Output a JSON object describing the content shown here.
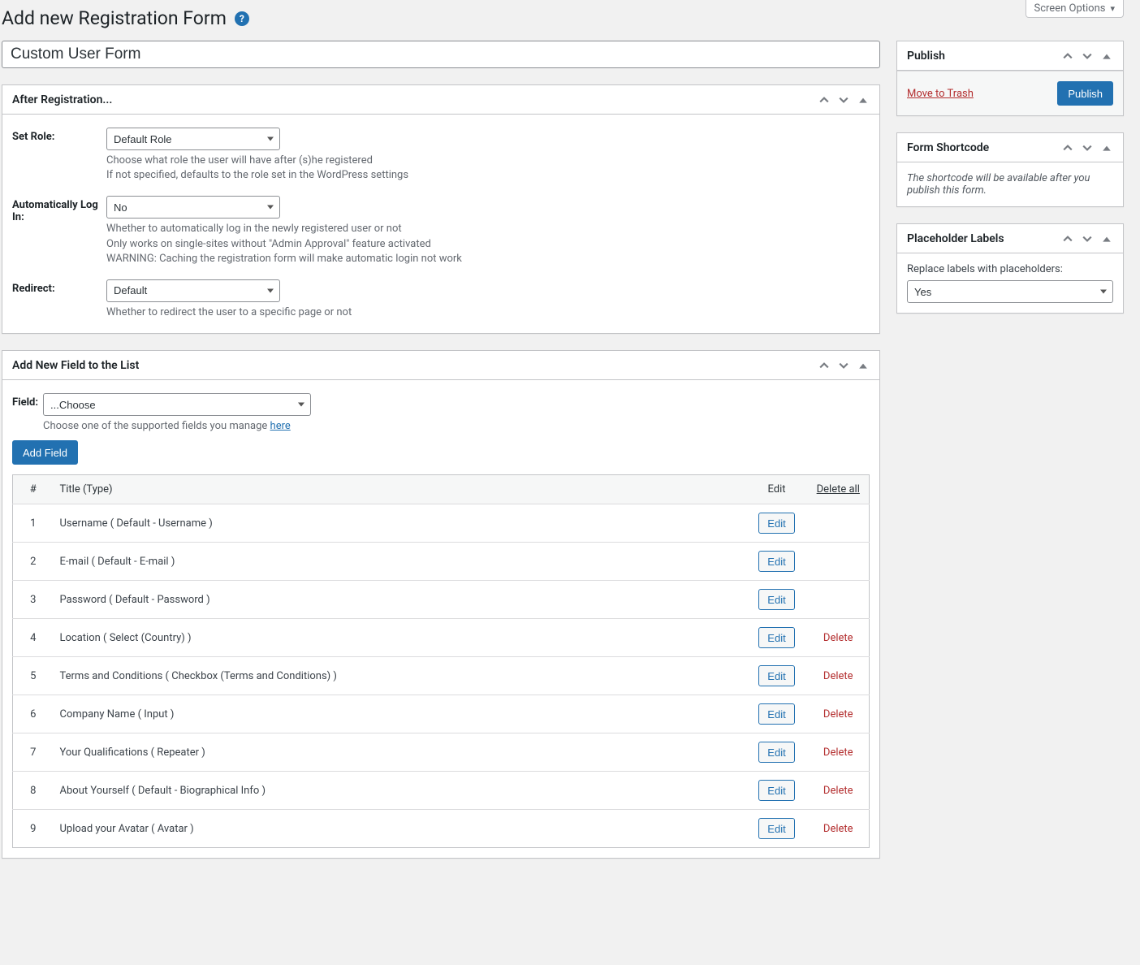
{
  "screen_options": "Screen Options",
  "page_title": "Add new Registration Form",
  "help_icon_label": "?",
  "title_input_value": "Custom User Form",
  "after_reg": {
    "box_title": "After Registration...",
    "set_role_label": "Set Role:",
    "set_role_value": "Default Role",
    "set_role_desc": "Choose what role the user will have after (s)he registered\nIf not specified, defaults to the role set in the WordPress settings",
    "auto_login_label": "Automatically Log In:",
    "auto_login_value": "No",
    "auto_login_desc": "Whether to automatically log in the newly registered user or not\nOnly works on single-sites without \"Admin Approval\" feature activated\nWARNING: Caching the registration form will make automatic login not work",
    "redirect_label": "Redirect:",
    "redirect_value": "Default",
    "redirect_desc": "Whether to redirect the user to a specific page or not"
  },
  "add_field": {
    "box_title": "Add New Field to the List",
    "field_label": "Field:",
    "field_select_value": "...Choose",
    "desc_prefix": "Choose one of the supported fields you manage ",
    "desc_link": "here",
    "add_button": "Add Field",
    "col_num": "#",
    "col_title": "Title (Type)",
    "col_edit": "Edit",
    "col_delete": "Delete all",
    "edit_btn": "Edit",
    "delete_btn": "Delete",
    "rows": [
      {
        "n": "1",
        "title": "Username ( Default - Username )",
        "deletable": false
      },
      {
        "n": "2",
        "title": "E-mail ( Default - E-mail )",
        "deletable": false
      },
      {
        "n": "3",
        "title": "Password ( Default - Password )",
        "deletable": false
      },
      {
        "n": "4",
        "title": "Location ( Select (Country) )",
        "deletable": true
      },
      {
        "n": "5",
        "title": "Terms and Conditions ( Checkbox (Terms and Conditions) )",
        "deletable": true
      },
      {
        "n": "6",
        "title": "Company Name ( Input )",
        "deletable": true
      },
      {
        "n": "7",
        "title": "Your Qualifications ( Repeater )",
        "deletable": true
      },
      {
        "n": "8",
        "title": "About Yourself ( Default - Biographical Info )",
        "deletable": true
      },
      {
        "n": "9",
        "title": "Upload your Avatar ( Avatar )",
        "deletable": true
      }
    ]
  },
  "publish_box": {
    "title": "Publish",
    "trash": "Move to Trash",
    "publish_btn": "Publish"
  },
  "shortcode_box": {
    "title": "Form Shortcode",
    "text": "The shortcode will be available after you publish this form."
  },
  "placeholder_box": {
    "title": "Placeholder Labels",
    "label": "Replace labels with placeholders:",
    "value": "Yes"
  }
}
